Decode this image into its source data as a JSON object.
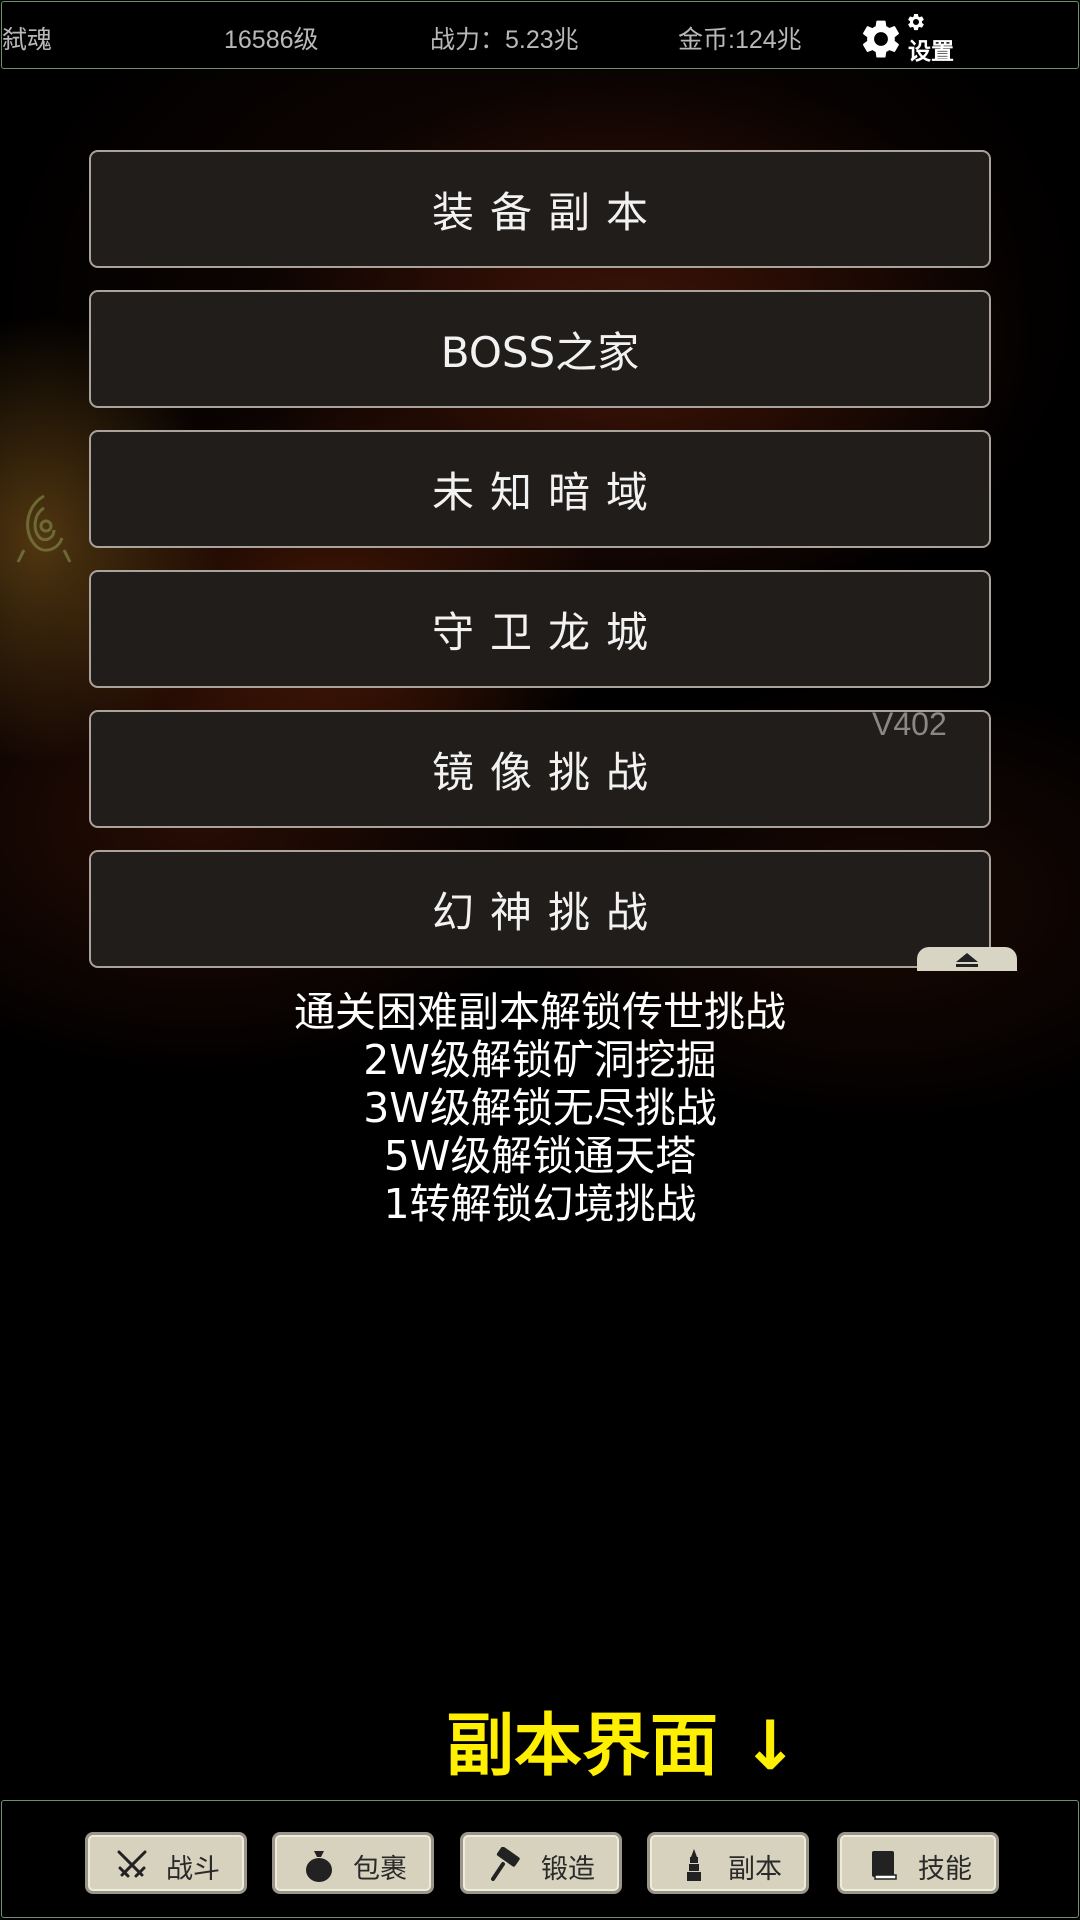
{
  "status_bar": {
    "player_name": "弑魂",
    "level": "16586级",
    "combat_power": "战力：5.23兆",
    "gold": "金币:124兆",
    "settings_label": "设置"
  },
  "menu": {
    "buttons": [
      {
        "label": "装备副本"
      },
      {
        "label": "BOSS之家"
      },
      {
        "label": "未知暗域"
      },
      {
        "label": "守卫龙城"
      },
      {
        "label": "镜像挑战"
      },
      {
        "label": "幻神挑战"
      }
    ],
    "version": "V402"
  },
  "unlock_hints": [
    "通关困难副本解锁传世挑战",
    "2W级解锁矿洞挖掘",
    "3W级解锁无尽挑战",
    "5W级解锁通天塔",
    "1转解锁幻境挑战"
  ],
  "caption": "副本界面 ↓",
  "colors": {
    "caption": "#ffef00",
    "button_bg": "#201d1b",
    "button_border": "#a9a39b",
    "nav_bg": "#d6d2bd"
  },
  "bottom_nav": {
    "items": [
      {
        "label": "战斗",
        "icon": "crossed-swords-icon"
      },
      {
        "label": "包裹",
        "icon": "bag-icon"
      },
      {
        "label": "锻造",
        "icon": "hammer-icon"
      },
      {
        "label": "副本",
        "icon": "tower-icon"
      },
      {
        "label": "技能",
        "icon": "book-icon"
      }
    ]
  }
}
